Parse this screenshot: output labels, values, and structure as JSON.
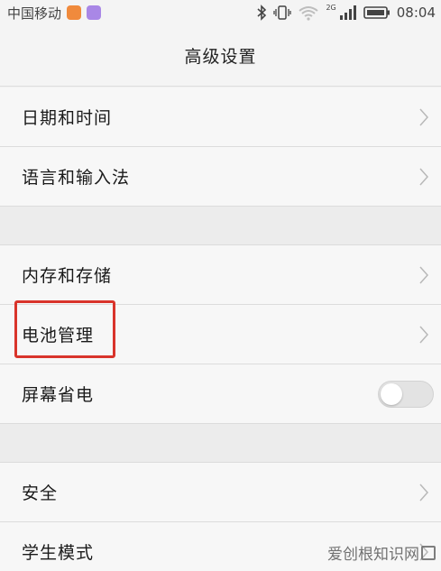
{
  "status_bar": {
    "carrier": "中国移动",
    "network_type": "2G",
    "time": "08:04"
  },
  "header": {
    "title": "高级设置"
  },
  "settings": {
    "date_time": "日期和时间",
    "language_input": "语言和输入法",
    "storage": "内存和存储",
    "battery": "电池管理",
    "screen_saver": "屏幕省电",
    "screen_saver_enabled": false,
    "security": "安全",
    "student_mode": "学生模式"
  },
  "watermark": {
    "text": "爱创根知识网"
  },
  "colors": {
    "highlight": "#d9342b",
    "background": "#f0f0f0"
  }
}
